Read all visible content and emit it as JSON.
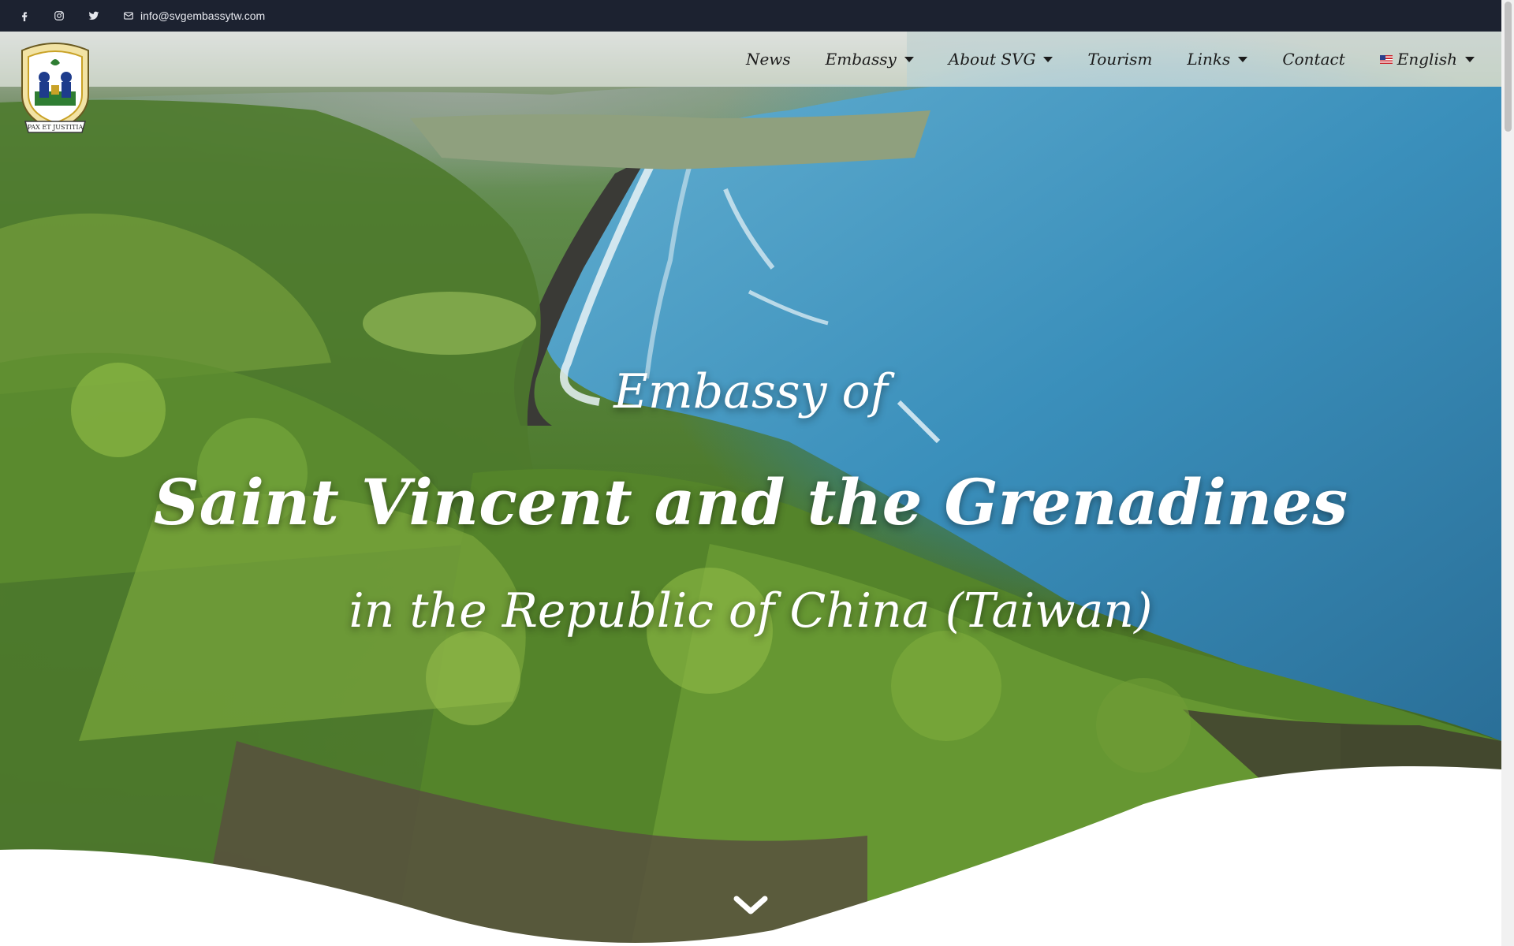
{
  "topbar": {
    "social": [
      "facebook-icon",
      "instagram-icon",
      "twitter-icon"
    ],
    "email": "info@svgembassytw.com"
  },
  "nav": {
    "items": [
      {
        "label": "News",
        "dropdown": false
      },
      {
        "label": "Embassy",
        "dropdown": true
      },
      {
        "label": "About SVG",
        "dropdown": true
      },
      {
        "label": "Tourism",
        "dropdown": false
      },
      {
        "label": "Links",
        "dropdown": true
      },
      {
        "label": "Contact",
        "dropdown": false
      }
    ],
    "language": "English"
  },
  "logo": {
    "motto": "PAX ET JUSTITIA"
  },
  "hero": {
    "line1": "Embassy of",
    "line2": "Saint Vincent and the Grenadines",
    "line3": "in the Republic of China (Taiwan)"
  }
}
